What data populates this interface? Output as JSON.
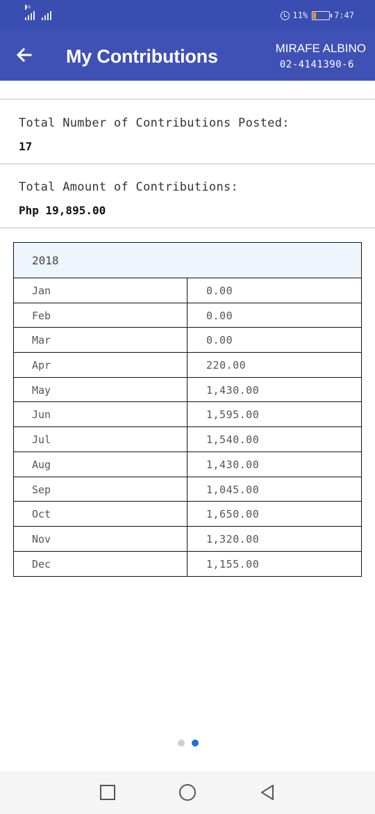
{
  "status_bar": {
    "network_type": "4G",
    "battery_percent": "11%",
    "time": "7:47"
  },
  "app_bar": {
    "title": "My Contributions",
    "member_name": "MIRAFE ALBINO",
    "member_id": "02-4141390-6"
  },
  "summary": {
    "total_posted_label": "Total Number of Contributions Posted:",
    "total_posted_value": "17",
    "total_amount_label": "Total Amount of Contributions:",
    "total_amount_value": "Php 19,895.00"
  },
  "contributions_table": {
    "year": "2018",
    "rows": [
      {
        "month": "Jan",
        "amount": "0.00"
      },
      {
        "month": "Feb",
        "amount": "0.00"
      },
      {
        "month": "Mar",
        "amount": "0.00"
      },
      {
        "month": "Apr",
        "amount": "220.00"
      },
      {
        "month": "May",
        "amount": "1,430.00"
      },
      {
        "month": "Jun",
        "amount": "1,595.00"
      },
      {
        "month": "Jul",
        "amount": "1,540.00"
      },
      {
        "month": "Aug",
        "amount": "1,430.00"
      },
      {
        "month": "Sep",
        "amount": "1,045.00"
      },
      {
        "month": "Oct",
        "amount": "1,650.00"
      },
      {
        "month": "Nov",
        "amount": "1,320.00"
      },
      {
        "month": "Dec",
        "amount": "1,155.00"
      }
    ]
  },
  "pager": {
    "page_count": 2,
    "active_page": 2,
    "active_color": "#1e6fd9",
    "inactive_color": "#cfcfcf"
  },
  "colors": {
    "status_bar": "#3a4db0",
    "app_bar": "#3f51b5",
    "table_header": "#eef5fd",
    "battery_level": "#ff9800"
  },
  "icons": {
    "back": "arrow-left-icon",
    "alarm": "alarm-icon",
    "battery": "battery-icon",
    "nav_recents": "square-icon",
    "nav_home": "circle-icon",
    "nav_back": "triangle-left-icon"
  }
}
